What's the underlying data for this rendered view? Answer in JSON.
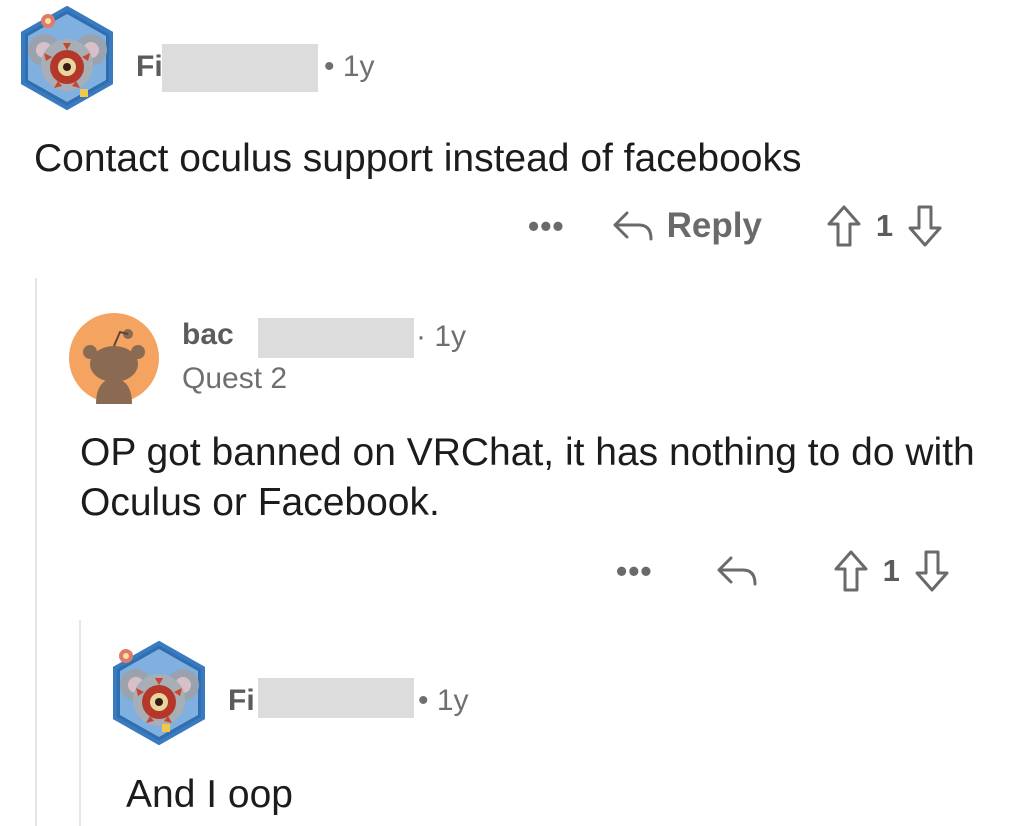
{
  "comments": [
    {
      "username": "Fi",
      "age": "1y",
      "body": "Contact oculus support instead of facebooks",
      "reply_label": "Reply",
      "vote_count": "1",
      "more": "•••"
    },
    {
      "username": "bac",
      "age": "1y",
      "flair": "Quest 2",
      "body": "OP got banned on VRChat, it has nothing to do with Oculus or Facebook.",
      "vote_count": "1",
      "more": "•••"
    },
    {
      "username": "Fi",
      "age": "1y",
      "body": "And I oop"
    }
  ],
  "colors": {
    "avatar_hex_border": "#3a6da8",
    "snoo_bg": "#f4a460",
    "redaction": "#dcdcdc"
  },
  "icons": [
    "koala-avatar-icon",
    "snoo-avatar-icon",
    "reply-arrow-icon",
    "upvote-icon",
    "downvote-icon",
    "more-icon"
  ]
}
